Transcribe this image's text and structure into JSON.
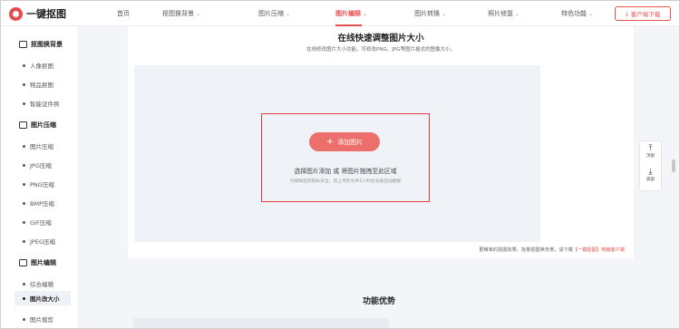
{
  "header": {
    "brand": "一键抠图",
    "nav": [
      {
        "label": "首页",
        "has_chevron": false,
        "active": false
      },
      {
        "label": "抠图换背景",
        "has_chevron": true,
        "active": false
      },
      {
        "label": "图片压缩",
        "has_chevron": true,
        "active": false
      },
      {
        "label": "图片编辑",
        "has_chevron": true,
        "active": true
      },
      {
        "label": "图片转换",
        "has_chevron": true,
        "active": false
      },
      {
        "label": "照片修复",
        "has_chevron": true,
        "active": false
      },
      {
        "label": "特色功能",
        "has_chevron": true,
        "active": false
      },
      {
        "label": "客户端",
        "has_chevron": true,
        "active": false
      },
      {
        "label": "常见问题",
        "has_chevron": false,
        "active": false
      }
    ],
    "download_label": "客户端下载",
    "download_icon": "download-icon",
    "accent": "#e85050"
  },
  "sidebar": {
    "groups": [
      {
        "label": "抠图换背景",
        "items": [
          "人像抠图",
          "物品抠图",
          "智能证件照"
        ]
      },
      {
        "label": "图片压缩",
        "items": [
          "图片压缩",
          "JPG压缩",
          "PNG压缩",
          "BMP压缩",
          "GIF压缩",
          "JPEG压缩"
        ]
      },
      {
        "label": "图片编辑",
        "items": [
          "综合编辑",
          "图片改大小",
          "图片裁剪"
        ]
      }
    ],
    "active_item": "图片改大小"
  },
  "main": {
    "title": "在线快速调整图片大小",
    "subtitle": "在线修改图片大小功能，可修改PNG、JPG等图片格式的图像大小。",
    "upload": {
      "button_label": "添加图片",
      "hint": "选择图片添加 或 将图片拖拽至此区域",
      "note": "为保障您的隐私安全，您上传的文件1小时后会被自动删除"
    },
    "footer_note": "更精准的抠图效果、批量抠图换背景，请下载",
    "footer_link": "【一键抠图】电脑客户端",
    "section_title": "功能优势"
  },
  "float_tools": {
    "top_label": "顶部",
    "bottom_label": "底部"
  }
}
